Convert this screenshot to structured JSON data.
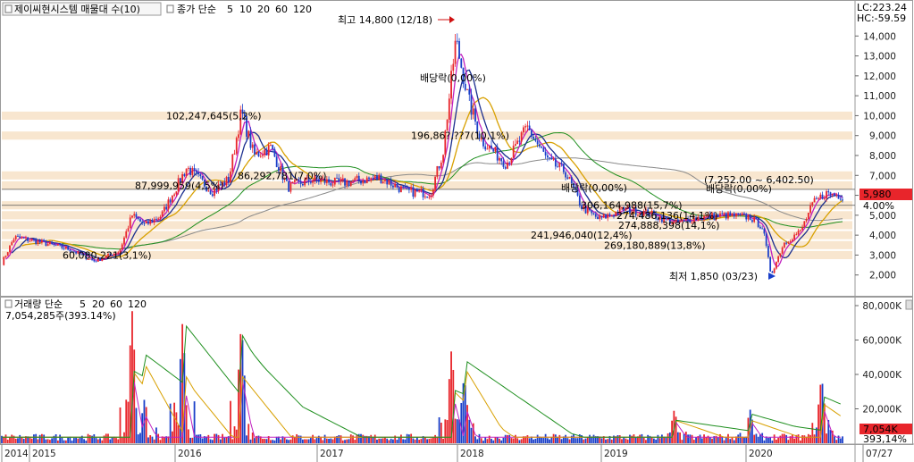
{
  "header": {
    "main_title": "제이씨현시스템 매물대 수(10)",
    "ma_label": "종가 단순",
    "ma_periods": [
      "5",
      "10",
      "20",
      "60",
      "120"
    ],
    "lc": "LC:223.24",
    "hc": "HC:-59.59"
  },
  "vol_header": {
    "title": "거래량 단순",
    "ma_periods": [
      "5",
      "20",
      "60",
      "120"
    ],
    "value": "7,054,285주(393.14%)"
  },
  "colors": {
    "up": "#e8252b",
    "down": "#1a3fc9",
    "ma5": "#c020c0",
    "ma10": "#1b2f8f",
    "ma20": "#d8a000",
    "ma60": "#1f8f1f",
    "ma120": "#8a8a8a",
    "vp_bar": "#f8e6cf"
  },
  "chart_data": {
    "type": "candlestick",
    "x_range": [
      "2014",
      "07/27"
    ],
    "year_labels": [
      "2014",
      "2015",
      "2016",
      "2017",
      "2018",
      "2019",
      "2020",
      "07/27"
    ],
    "price_axis": {
      "min": 1000,
      "max": 15000,
      "ticks": [
        "2,000",
        "3,000",
        "4,000",
        "5,000",
        "6,000",
        "7,000",
        "8,000",
        "9,000",
        "10,000",
        "11,000",
        "12,000",
        "13,000",
        "14,000"
      ]
    },
    "volume_axis": {
      "min": 0,
      "max": 80000,
      "ticks": [
        "20,000K",
        "40,000K",
        "60,000K",
        "80,000K"
      ]
    },
    "price_keypoints": [
      {
        "t": 0.0,
        "p": 2600
      },
      {
        "t": 0.015,
        "p": 3900
      },
      {
        "t": 0.04,
        "p": 3700
      },
      {
        "t": 0.08,
        "p": 3300
      },
      {
        "t": 0.11,
        "p": 2700
      },
      {
        "t": 0.14,
        "p": 3200
      },
      {
        "t": 0.155,
        "p": 5000
      },
      {
        "t": 0.17,
        "p": 4500
      },
      {
        "t": 0.19,
        "p": 5000
      },
      {
        "t": 0.22,
        "p": 7400
      },
      {
        "t": 0.25,
        "p": 6200
      },
      {
        "t": 0.27,
        "p": 6800
      },
      {
        "t": 0.285,
        "p": 10200
      },
      {
        "t": 0.3,
        "p": 8000
      },
      {
        "t": 0.32,
        "p": 8400
      },
      {
        "t": 0.34,
        "p": 6400
      },
      {
        "t": 0.37,
        "p": 6800
      },
      {
        "t": 0.4,
        "p": 6600
      },
      {
        "t": 0.45,
        "p": 6900
      },
      {
        "t": 0.48,
        "p": 6200
      },
      {
        "t": 0.51,
        "p": 6100
      },
      {
        "t": 0.525,
        "p": 8200
      },
      {
        "t": 0.54,
        "p": 13800
      },
      {
        "t": 0.555,
        "p": 10800
      },
      {
        "t": 0.57,
        "p": 8800
      },
      {
        "t": 0.6,
        "p": 7600
      },
      {
        "t": 0.625,
        "p": 9400
      },
      {
        "t": 0.65,
        "p": 7700
      },
      {
        "t": 0.67,
        "p": 7200
      },
      {
        "t": 0.69,
        "p": 5400
      },
      {
        "t": 0.71,
        "p": 4800
      },
      {
        "t": 0.74,
        "p": 5300
      },
      {
        "t": 0.77,
        "p": 5100
      },
      {
        "t": 0.8,
        "p": 4600
      },
      {
        "t": 0.83,
        "p": 4900
      },
      {
        "t": 0.86,
        "p": 5000
      },
      {
        "t": 0.89,
        "p": 4900
      },
      {
        "t": 0.905,
        "p": 4400
      },
      {
        "t": 0.915,
        "p": 2000
      },
      {
        "t": 0.93,
        "p": 3600
      },
      {
        "t": 0.95,
        "p": 4200
      },
      {
        "t": 0.965,
        "p": 5600
      },
      {
        "t": 0.98,
        "p": 6100
      },
      {
        "t": 1.0,
        "p": 5980
      }
    ],
    "volume_spikes": [
      {
        "t": 0.155,
        "v": 78000
      },
      {
        "t": 0.17,
        "v": 27000
      },
      {
        "t": 0.215,
        "v": 71000
      },
      {
        "t": 0.285,
        "v": 72000
      },
      {
        "t": 0.535,
        "v": 56000
      },
      {
        "t": 0.55,
        "v": 40000
      },
      {
        "t": 0.8,
        "v": 20000
      },
      {
        "t": 0.89,
        "v": 20000
      },
      {
        "t": 0.975,
        "v": 40000
      }
    ],
    "volume_profile": [
      {
        "label": "60,080,221(3,1%)",
        "low": 2750,
        "high": 3250
      },
      {
        "label": "241,946,040(12,4%)",
        "low": 3750,
        "high": 4250
      },
      {
        "label": "269,180,889(13,8%)",
        "low": 3250,
        "high": 3750
      },
      {
        "label": "274,888,398(14,1%)",
        "low": 4250,
        "high": 4750
      },
      {
        "label": "274,486,136(14,1%)",
        "low": 4750,
        "high": 5250
      },
      {
        "label": "306,164,988(15,7%)",
        "low": 5250,
        "high": 5750
      },
      {
        "label": "87,999,959(4,5%)",
        "low": 6250,
        "high": 6750
      },
      {
        "label": "86,292,781(7,0%)",
        "low": 6750,
        "high": 7250
      },
      {
        "label": "196,86?,??7(10,1%)",
        "low": 8750,
        "high": 9250
      },
      {
        "label": "102,247,645(5,2%)",
        "low": 9750,
        "high": 10250
      }
    ],
    "annotations": {
      "high": "최고 14,800 (12/18)",
      "low": "최저 1,850 (03/23)",
      "dividend": "배당락(0,00%)",
      "range": "(7,252.00 ~ 6,402.50)"
    },
    "current": {
      "price": "5,980",
      "change_pct": "4.00%",
      "vol": "7,054K",
      "vol_pct": "393,14%"
    }
  }
}
